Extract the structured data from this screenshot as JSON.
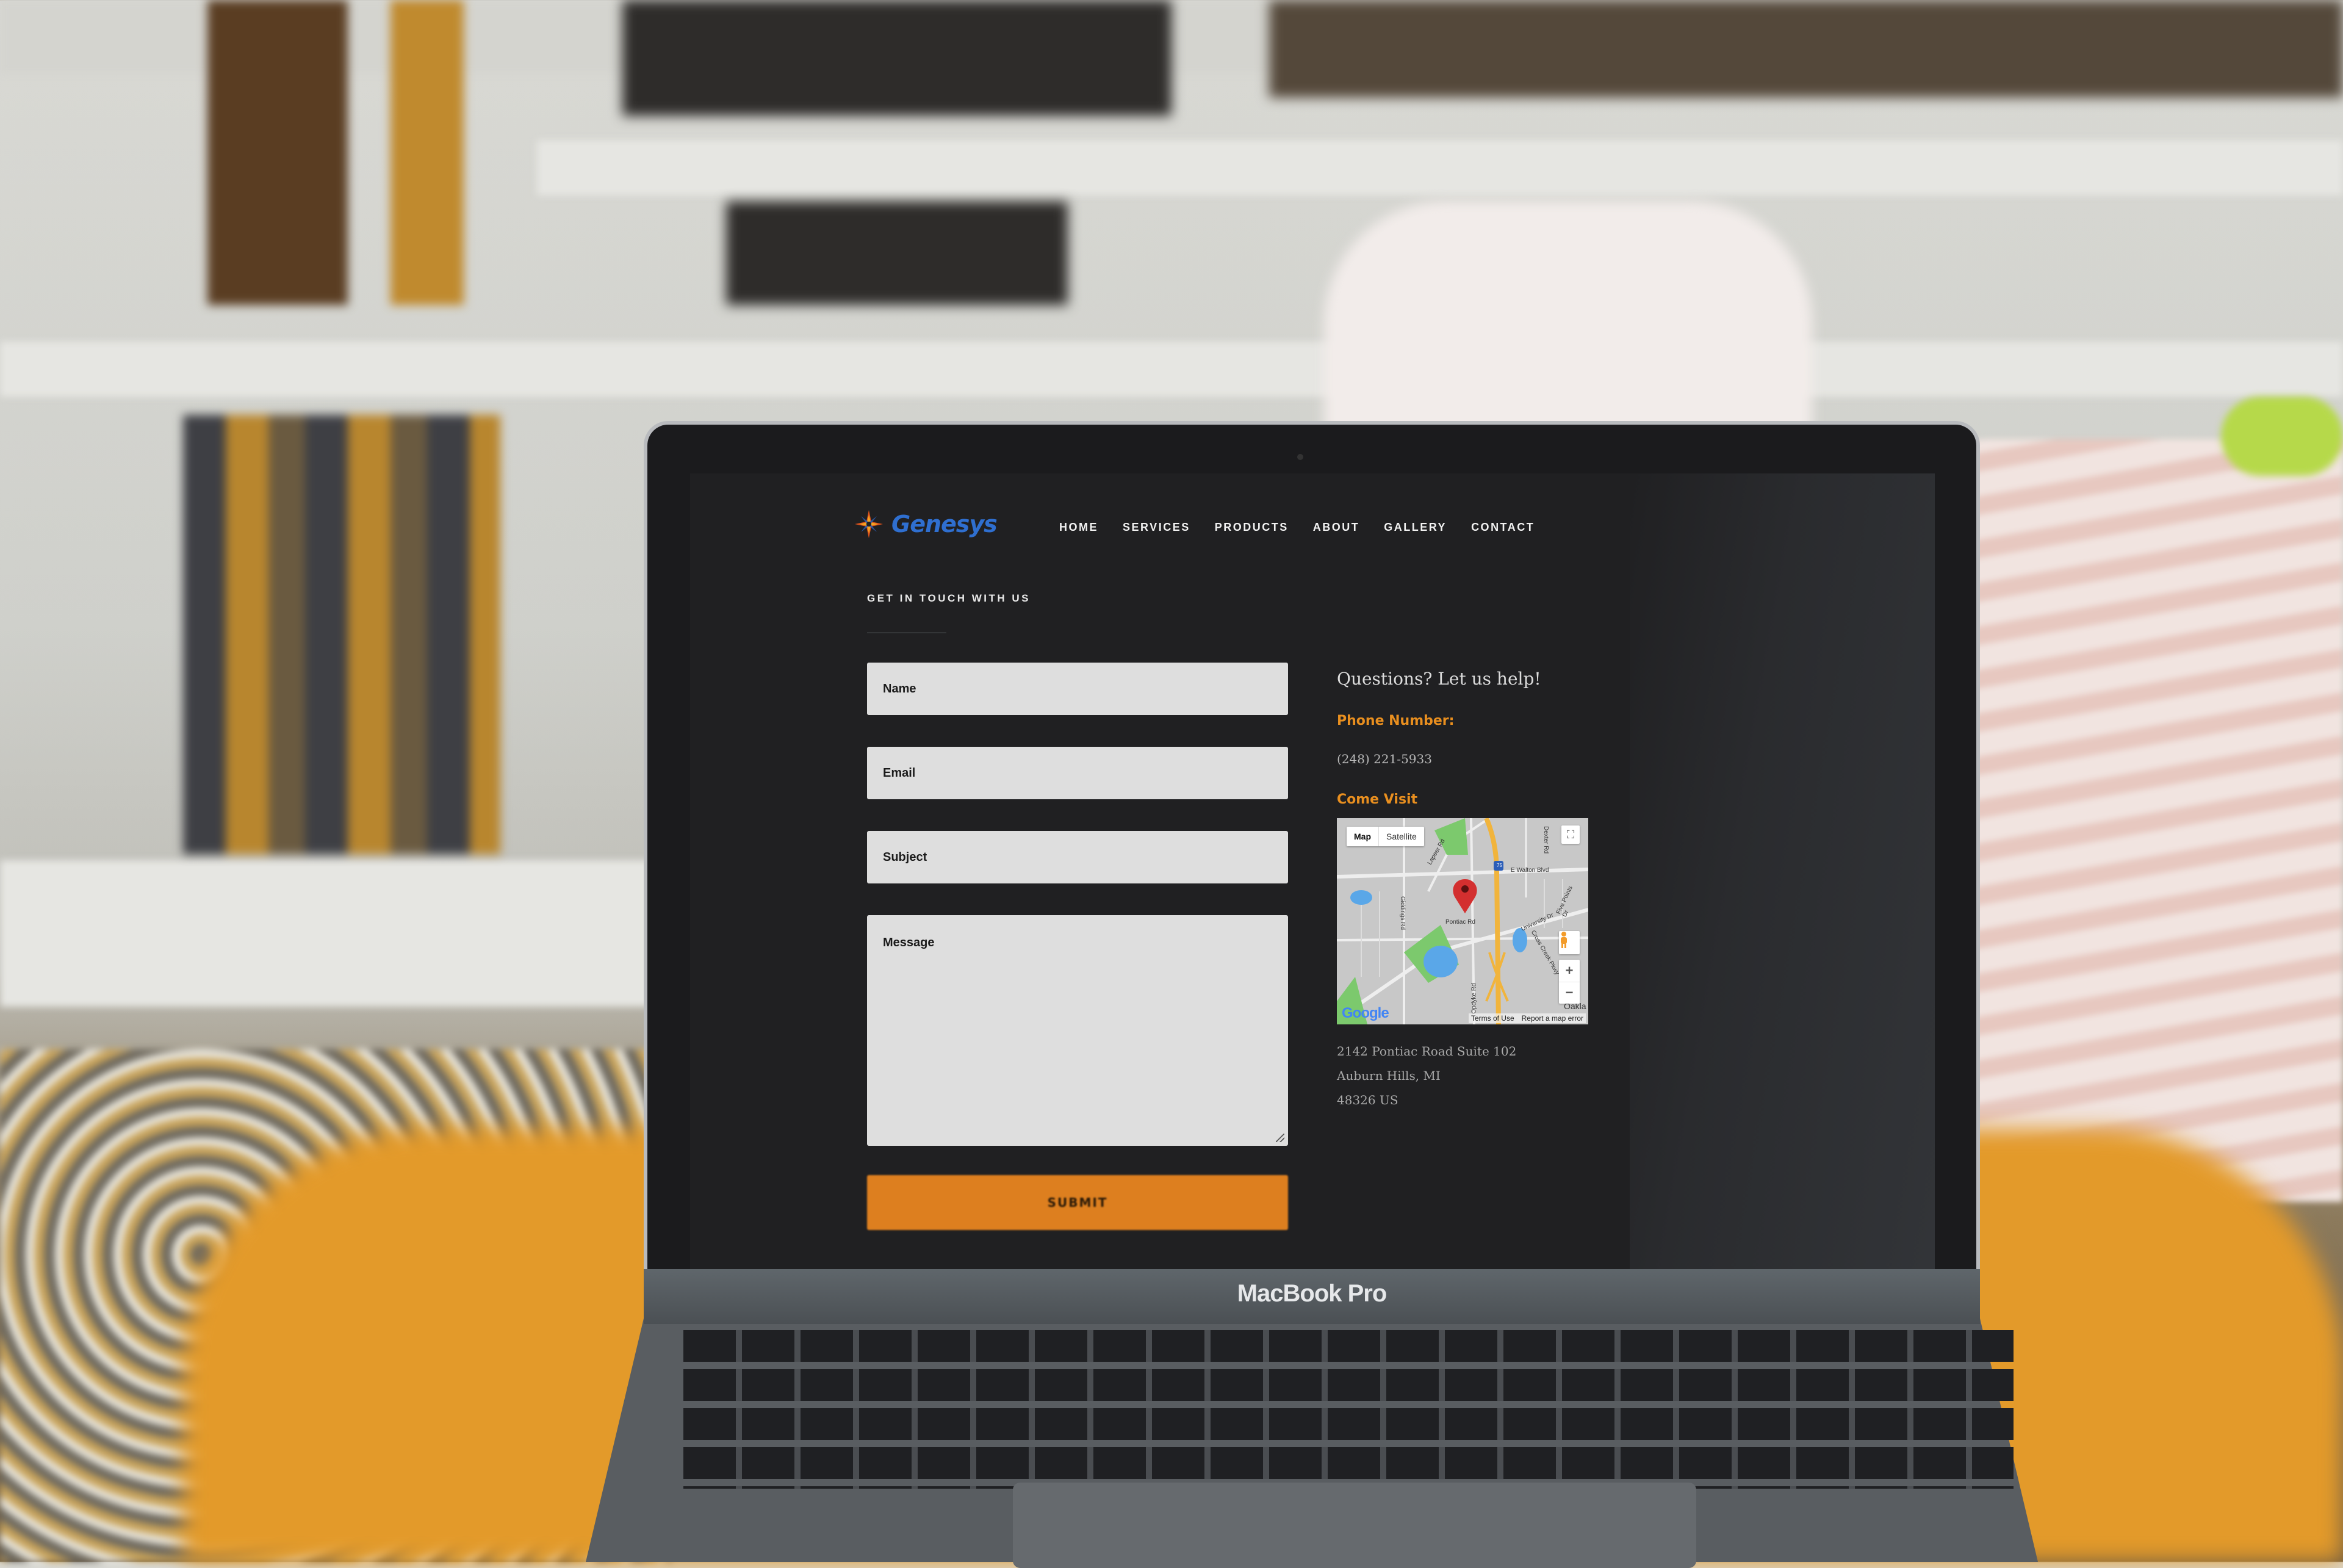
{
  "scene": {
    "device_label": "MacBook Pro"
  },
  "site": {
    "logo_text": "Genesys",
    "nav": [
      {
        "label": "HOME"
      },
      {
        "label": "SERVICES"
      },
      {
        "label": "PRODUCTS"
      },
      {
        "label": "ABOUT"
      },
      {
        "label": "GALLERY"
      },
      {
        "label": "CONTACT"
      }
    ],
    "eyebrow": "GET IN TOUCH WITH US",
    "form": {
      "name_placeholder": "Name",
      "email_placeholder": "Email",
      "subject_placeholder": "Subject",
      "message_placeholder": "Message",
      "submit_label": "SUBMIT"
    },
    "contact": {
      "heading": "Questions? Let us help!",
      "phone_label": "Phone Number:",
      "phone": "(248) 221-5933",
      "visit_label": "Come Visit",
      "address": [
        "2142 Pontiac Road Suite 102",
        "Auburn Hills, MI",
        "48326 US"
      ]
    },
    "map": {
      "toggle": [
        "Map",
        "Satellite"
      ],
      "active_toggle": "Map",
      "labels": {
        "walton": "E Walton Blvd",
        "lapeer": "Lapeer Rd",
        "giddings": "Giddings Rd",
        "pontiac": "Pontiac Rd",
        "university": "University Dr",
        "opdyke": "Opdyke Rd",
        "dexter": "Dexter Rd",
        "crosscreek": "Cross Creek Pkwy",
        "fivepoints": "Five Points Dr",
        "interstate": "75",
        "oakland": "Oakla"
      },
      "google": "Google",
      "terms": "Terms of Use",
      "report": "Report a map error",
      "zoom_in": "+",
      "zoom_out": "−"
    },
    "colors": {
      "accent": "#e98f1f",
      "button": "#dd7f1f",
      "background": "#202022",
      "logo": "#2f6fd0"
    }
  }
}
